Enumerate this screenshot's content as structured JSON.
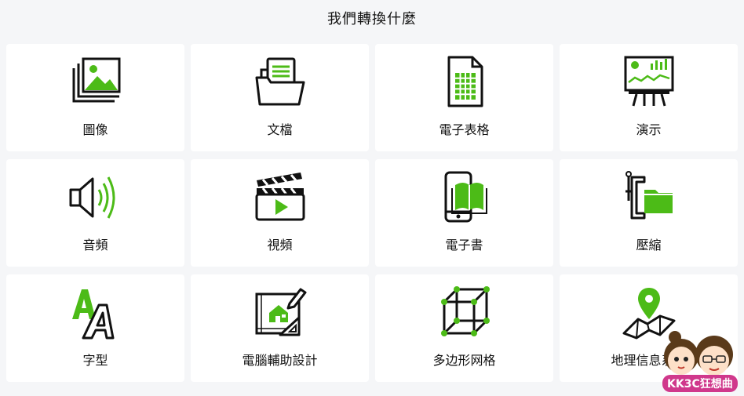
{
  "header": {
    "title": "我們轉換什麼"
  },
  "colors": {
    "accent": "#4cbb17",
    "ink": "#111111",
    "card": "#ffffff",
    "background": "#f5f6f8"
  },
  "categories": [
    {
      "label": "圖像",
      "icon": "image-icon"
    },
    {
      "label": "文檔",
      "icon": "document-folder-icon"
    },
    {
      "label": "電子表格",
      "icon": "spreadsheet-icon"
    },
    {
      "label": "演示",
      "icon": "presentation-board-icon"
    },
    {
      "label": "音頻",
      "icon": "speaker-icon"
    },
    {
      "label": "視頻",
      "icon": "clapperboard-icon"
    },
    {
      "label": "電子書",
      "icon": "ebook-phone-icon"
    },
    {
      "label": "壓縮",
      "icon": "clamp-folder-icon"
    },
    {
      "label": "字型",
      "icon": "font-letters-icon"
    },
    {
      "label": "電腦輔助設計",
      "icon": "cad-blueprint-icon"
    },
    {
      "label": "多边形网格",
      "icon": "polygon-cube-icon"
    },
    {
      "label": "地理信息系统",
      "icon": "map-pin-icon"
    }
  ],
  "watermark": {
    "text": "KK3C狂想曲"
  }
}
